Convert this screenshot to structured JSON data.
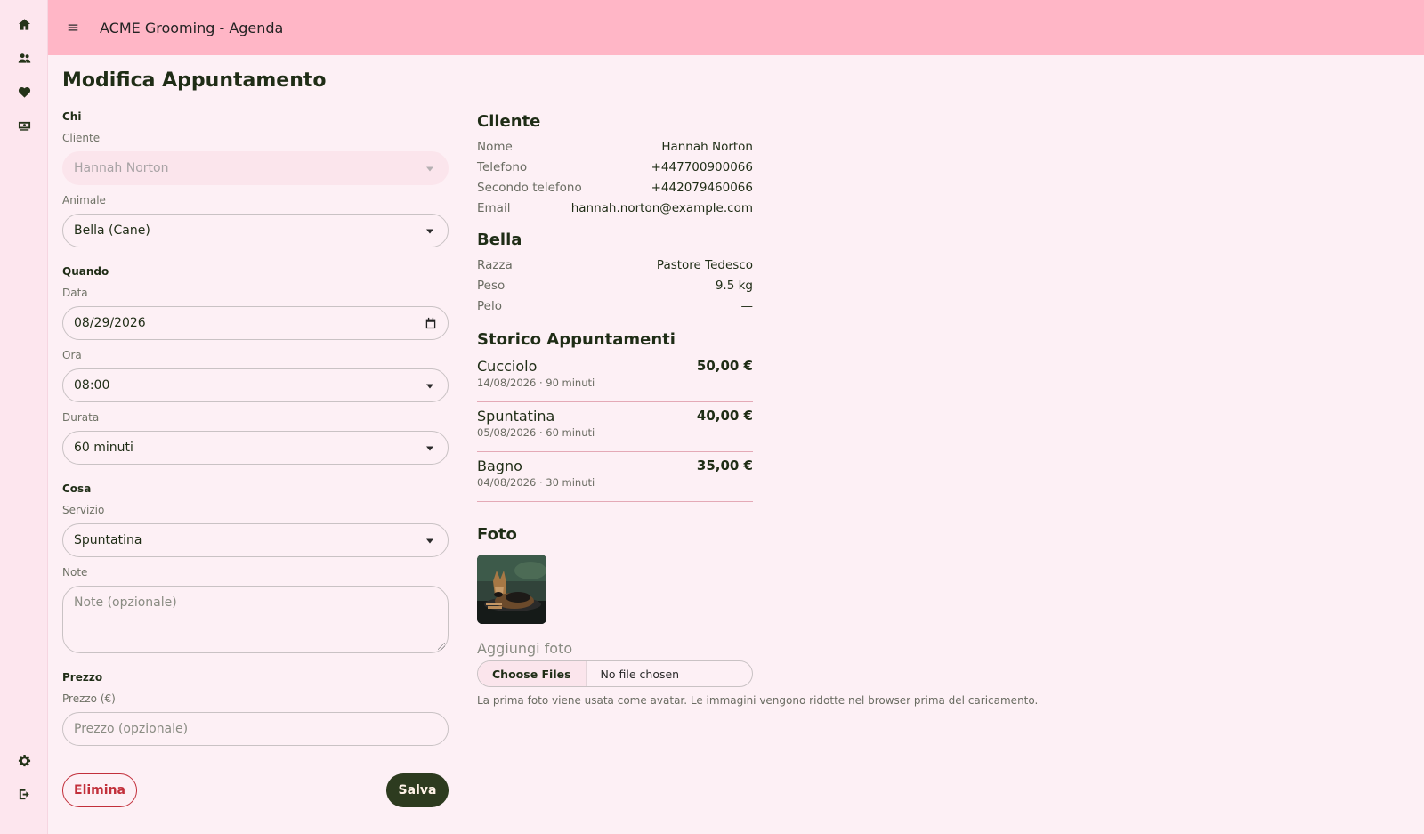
{
  "app": {
    "title": "ACME Grooming - Agenda"
  },
  "rail": {
    "items": [
      {
        "icon": "home-icon"
      },
      {
        "icon": "users-icon"
      },
      {
        "icon": "heart-icon"
      },
      {
        "icon": "cash-icon"
      }
    ],
    "bottom": [
      {
        "icon": "gear-icon"
      },
      {
        "icon": "logout-icon"
      }
    ]
  },
  "page": {
    "title": "Modifica Appuntamento"
  },
  "form": {
    "who": {
      "heading": "Chi",
      "client_label": "Cliente",
      "client_value": "Hannah Norton",
      "pet_label": "Animale",
      "pet_value": "Bella (Cane)"
    },
    "when": {
      "heading": "Quando",
      "date_label": "Data",
      "date_value": "08/29/2026",
      "time_label": "Ora",
      "time_value": "08:00",
      "duration_label": "Durata",
      "duration_value": "60 minuti"
    },
    "what": {
      "heading": "Cosa",
      "service_label": "Servizio",
      "service_value": "Spuntatina",
      "notes_label": "Note",
      "notes_placeholder": "Note (opzionale)"
    },
    "price": {
      "heading": "Prezzo",
      "price_label": "Prezzo (€)",
      "price_placeholder": "Prezzo (opzionale)"
    },
    "delete_label": "Elimina",
    "save_label": "Salva"
  },
  "client": {
    "heading": "Cliente",
    "rows": [
      {
        "k": "Nome",
        "v": "Hannah Norton"
      },
      {
        "k": "Telefono",
        "v": "+447700900066"
      },
      {
        "k": "Secondo telefono",
        "v": "+442079460066"
      },
      {
        "k": "Email",
        "v": "hannah.norton@example.com"
      }
    ]
  },
  "pet": {
    "heading": "Bella",
    "rows": [
      {
        "k": "Razza",
        "v": "Pastore Tedesco"
      },
      {
        "k": "Peso",
        "v": "9.5 kg"
      },
      {
        "k": "Pelo",
        "v": "—"
      }
    ]
  },
  "history": {
    "heading": "Storico Appuntamenti",
    "items": [
      {
        "service": "Cucciolo",
        "meta": "14/08/2026 · 90 minuti",
        "price": "50,00 €"
      },
      {
        "service": "Spuntatina",
        "meta": "05/08/2026 · 60 minuti",
        "price": "40,00 €"
      },
      {
        "service": "Bagno",
        "meta": "04/08/2026 · 30 minuti",
        "price": "35,00 €"
      }
    ]
  },
  "photos": {
    "heading": "Foto",
    "add_label": "Aggiungi foto",
    "choose_label": "Choose Files",
    "no_file": "No file chosen",
    "hint": "La prima foto viene usata come avatar. Le immagini vengono ridotte nel browser prima del caricamento."
  }
}
